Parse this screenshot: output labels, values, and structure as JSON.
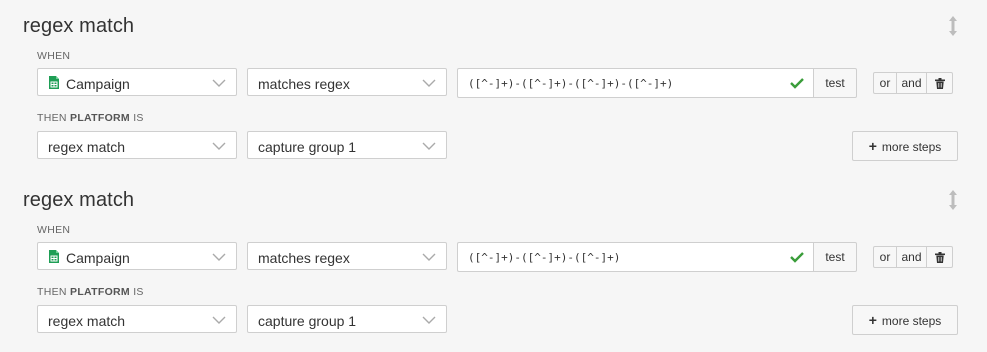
{
  "rules": [
    {
      "title": "regex match",
      "when_label": "WHEN",
      "field": {
        "icon": "spreadsheet-icon",
        "value": "Campaign"
      },
      "operator": "matches regex",
      "pattern": "([^-]+)-([^-]+)-([^-]+)-([^-]+)",
      "pattern_valid_icon": "checkmark-icon",
      "test_label": "test",
      "or_label": "or",
      "and_label": "and",
      "delete_icon": "trash-icon",
      "then_prefix": "THEN",
      "then_target": "PLATFORM",
      "then_suffix": "IS",
      "then_function": "regex match",
      "then_argument": "capture group 1",
      "more_steps_label": "more steps"
    },
    {
      "title": "regex match",
      "when_label": "WHEN",
      "field": {
        "icon": "spreadsheet-icon",
        "value": "Campaign"
      },
      "operator": "matches regex",
      "pattern": "([^-]+)-([^-]+)-([^-]+)",
      "pattern_valid_icon": "checkmark-icon",
      "test_label": "test",
      "or_label": "or",
      "and_label": "and",
      "delete_icon": "trash-icon",
      "then_prefix": "THEN",
      "then_target": "PLATFORM",
      "then_suffix": "IS",
      "then_function": "regex match",
      "then_argument": "capture group 1",
      "more_steps_label": "more steps"
    }
  ],
  "colors": {
    "check_green": "#3a9d3a",
    "sheet_green": "#1e9e55",
    "background": "#f6f6f6"
  }
}
